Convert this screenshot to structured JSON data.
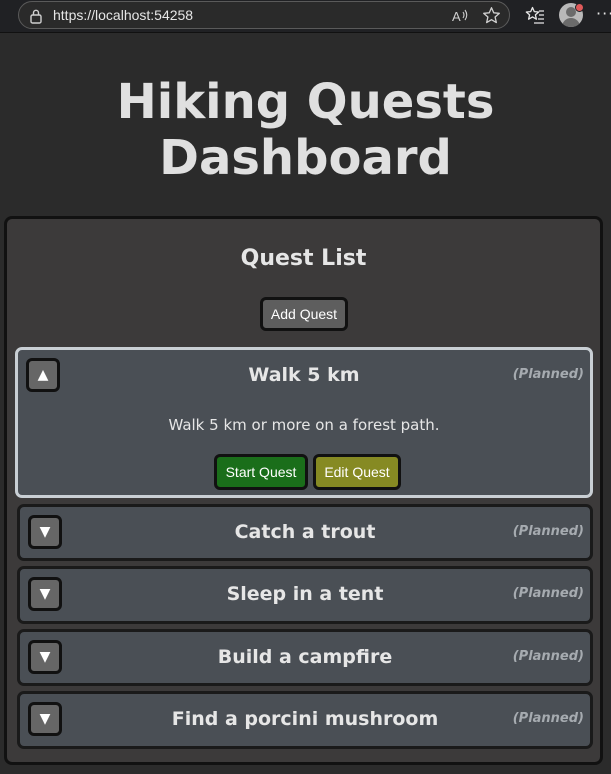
{
  "browser": {
    "url": "https://localhost:54258"
  },
  "page": {
    "title": "Hiking Quests Dashboard"
  },
  "quest_list": {
    "heading": "Quest List",
    "add_button_label": "Add Quest",
    "quests": [
      {
        "name": "Walk 5 km",
        "status": "(Planned)",
        "expanded": true,
        "toggle_symbol": "▲",
        "description": "Walk 5 km or more on a forest path.",
        "start_label": "Start Quest",
        "edit_label": "Edit Quest"
      },
      {
        "name": "Catch a trout",
        "status": "(Planned)",
        "expanded": false,
        "toggle_symbol": "▼"
      },
      {
        "name": "Sleep in a tent",
        "status": "(Planned)",
        "expanded": false,
        "toggle_symbol": "▼"
      },
      {
        "name": "Build a campfire",
        "status": "(Planned)",
        "expanded": false,
        "toggle_symbol": "▼"
      },
      {
        "name": "Find a porcini mushroom",
        "status": "(Planned)",
        "expanded": false,
        "toggle_symbol": "▼"
      }
    ]
  },
  "colors": {
    "start_button": "#1a6e1a",
    "edit_button": "#868a23",
    "card_background": "#4a4f55",
    "panel_background": "#3c3a3a"
  }
}
